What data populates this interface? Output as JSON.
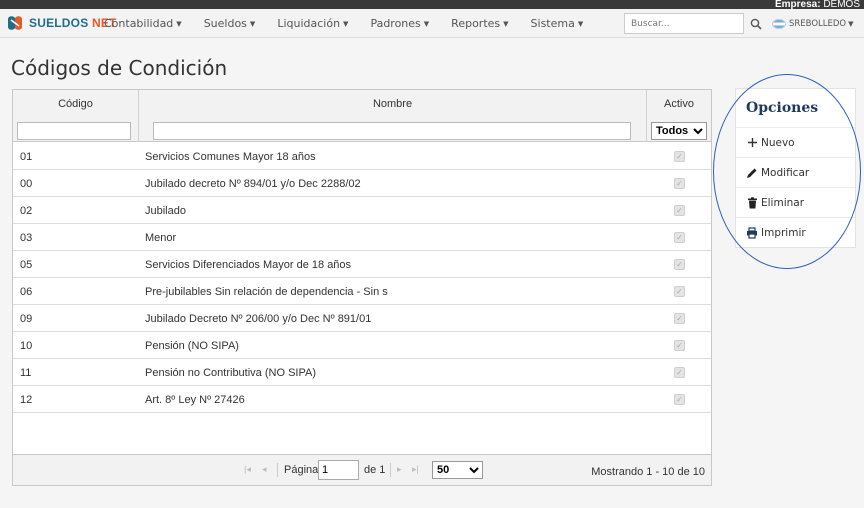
{
  "header": {
    "empresa_label": "Empresa:",
    "empresa_value": "DEMOS",
    "brand_left": "SUELDOS",
    "brand_right": "NET",
    "menu": [
      {
        "label": "Contabilidad"
      },
      {
        "label": "Sueldos"
      },
      {
        "label": "Liquidación"
      },
      {
        "label": "Padrones"
      },
      {
        "label": "Reportes"
      },
      {
        "label": "Sistema"
      }
    ],
    "search_placeholder": "Buscar...",
    "user": "SREBOLLEDO"
  },
  "page": {
    "title": "Códigos de Condición"
  },
  "table": {
    "columns": {
      "code": "Código",
      "name": "Nombre",
      "active": "Activo"
    },
    "active_filter": "Todos",
    "rows": [
      {
        "code": "01",
        "name": "Servicios Comunes Mayor 18 años",
        "active": true
      },
      {
        "code": "00",
        "name": "Jubilado decreto Nº 894/01 y/o Dec 2288/02",
        "active": true
      },
      {
        "code": "02",
        "name": "Jubilado",
        "active": true
      },
      {
        "code": "03",
        "name": "Menor",
        "active": true
      },
      {
        "code": "05",
        "name": "Servicios Diferenciados Mayor de 18 años",
        "active": true
      },
      {
        "code": "06",
        "name": "Pre-jubilables Sin relación de dependencia - Sin s",
        "active": true
      },
      {
        "code": "09",
        "name": "Jubilado Decreto Nº 206/00 y/o Dec Nº 891/01",
        "active": true
      },
      {
        "code": "10",
        "name": "Pensión (NO SIPA)",
        "active": true
      },
      {
        "code": "11",
        "name": "Pensión no Contributiva (NO SIPA)",
        "active": true
      },
      {
        "code": "12",
        "name": "Art. 8º Ley Nº 27426",
        "active": true
      }
    ],
    "pager": {
      "page_label": "Página",
      "page_value": "1",
      "of_label": "de 1",
      "page_size": "50",
      "showing": "Mostrando 1 - 10 de 10"
    }
  },
  "options": {
    "title": "Opciones",
    "items": [
      {
        "label": "Nuevo",
        "icon": "plus-icon"
      },
      {
        "label": "Modificar",
        "icon": "pencil-icon"
      },
      {
        "label": "Eliminar",
        "icon": "trash-icon"
      },
      {
        "label": "Imprimir",
        "icon": "printer-icon"
      }
    ]
  },
  "colors": {
    "accent_blue": "#1f3a5f",
    "brand_blue": "#1f6f8b",
    "brand_orange": "#e35a2b",
    "highlight_ellipse": "#2f5fbf"
  }
}
